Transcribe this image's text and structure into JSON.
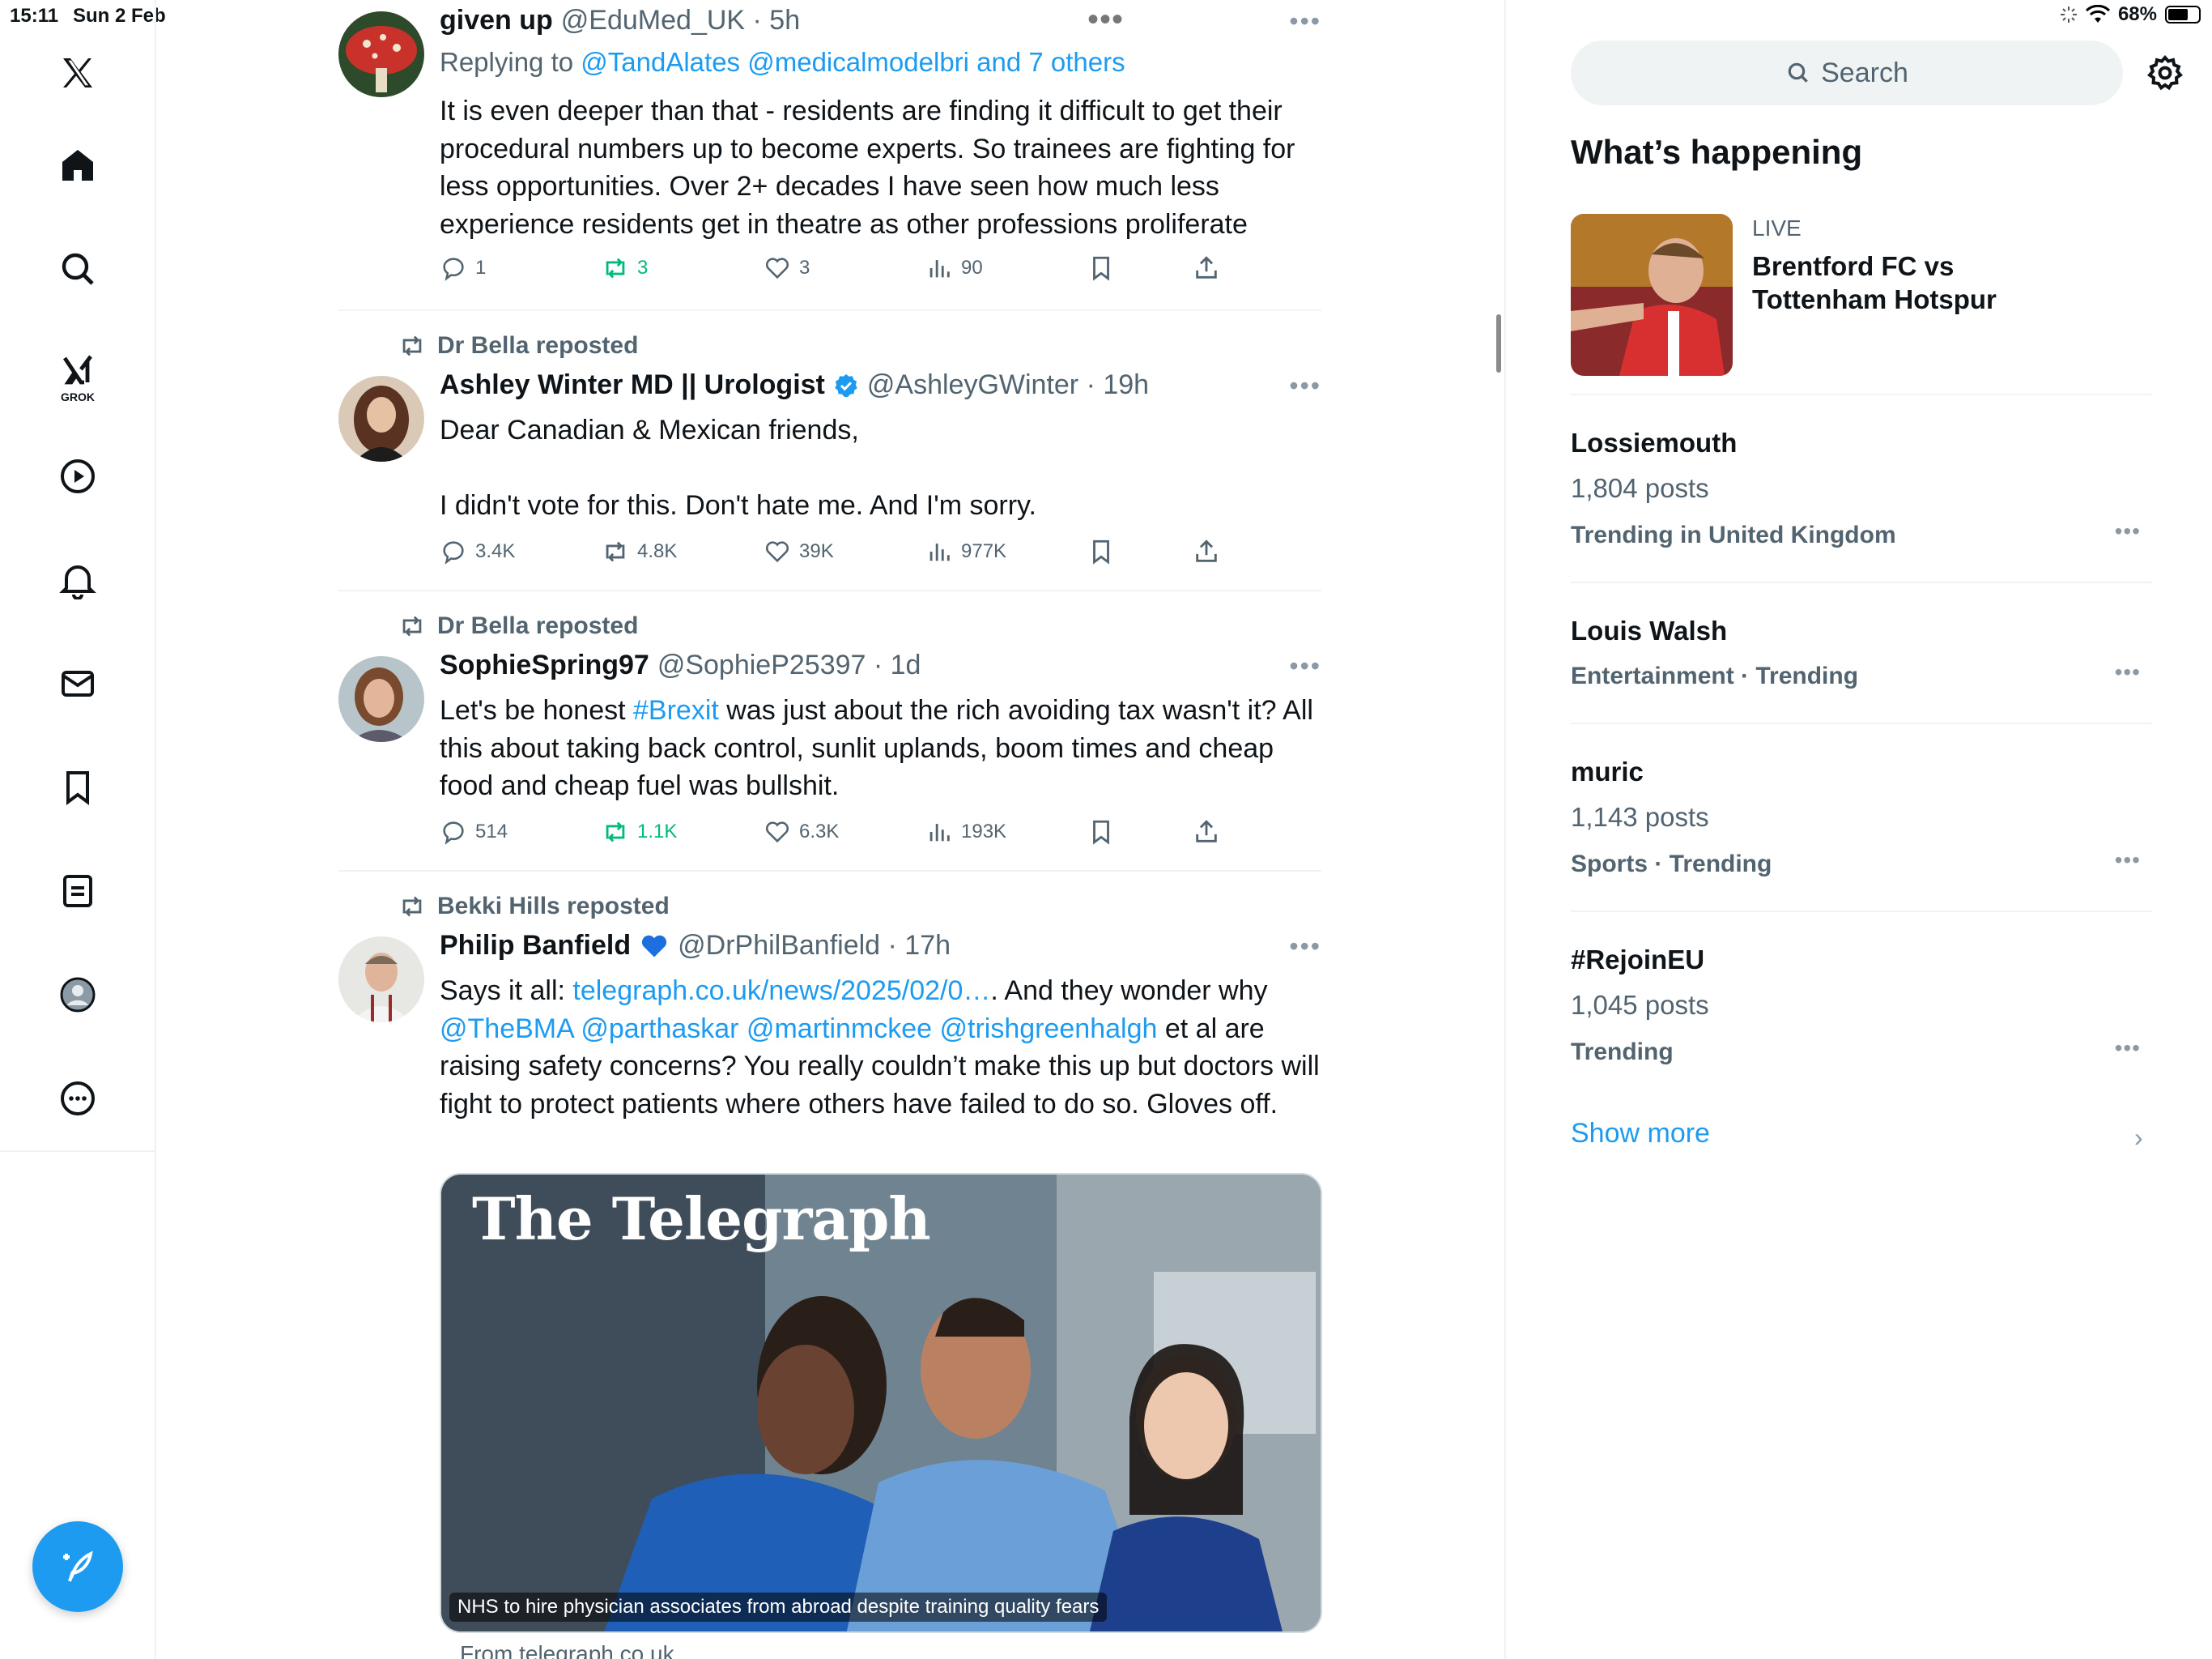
{
  "status": {
    "time": "15:11",
    "date": "Sun 2 Feb",
    "battery": "68%",
    "battery_level": 0.68
  },
  "nav": {
    "grok_label": "GROK"
  },
  "colors": {
    "accent": "#1d9bf0",
    "repost_green": "#00ba7c",
    "muted": "#536471"
  },
  "tweets": [
    {
      "name": "given up",
      "handle": "@EduMed_UK · 5h",
      "replying_prefix": "Replying to",
      "replying_to": "@TandAlates @medicalmodelbri and 7 others",
      "text": "It is even deeper than that - residents are finding it difficult to get their procedural numbers up to become experts. So trainees are fighting for less opportunities. Over 2+ decades I have seen how much less experience residents get in theatre as other professions proliferate",
      "replies": "1",
      "reposts": "3",
      "likes": "3",
      "views": "90"
    },
    {
      "repost_by": "Dr Bella reposted",
      "name": "Ashley Winter MD || Urologist",
      "handle": "@AshleyGWinter · 19h",
      "text_line1": "Dear Canadian & Mexican friends,",
      "text_line2": "I didn't vote for this. Don't hate me. And I'm sorry.",
      "replies": "3.4K",
      "reposts": "4.8K",
      "likes": "39K",
      "views": "977K"
    },
    {
      "repost_by": "Dr Bella reposted",
      "name": "SophieSpring97",
      "handle": "@SophieP25397 · 1d",
      "text_pre": "Let's be honest ",
      "hashtag": "#Brexit",
      "text_post": " was just about the rich avoiding tax wasn't it? All this about taking back control, sunlit uplands, boom times and cheap food and cheap fuel was bullshit.",
      "replies": "514",
      "reposts": "1.1K",
      "likes": "6.3K",
      "views": "193K"
    },
    {
      "repost_by": "Bekki Hills reposted",
      "name": "Philip Banfield",
      "handle": "@DrPhilBanfield · 17h",
      "text_pre": "Says it all: ",
      "link": "telegraph.co.uk/news/2025/02/0…",
      "text_mid": ". And they wonder why ",
      "mentions": "@TheBMA @parthaskar @martinmckee @trishgreenhalgh",
      "text_post": " et al are raising safety concerns? You really couldn’t make this up but doctors will fight to protect patients where others have failed to do so. Gloves off.",
      "card_title": "The Telegraph",
      "card_caption": "NHS to hire physician associates from abroad despite training quality fears",
      "card_from": "From telegraph.co.uk"
    }
  ],
  "right": {
    "search_placeholder": "Search",
    "heading": "What’s happening",
    "live_tag": "LIVE",
    "live_title": "Brentford FC vs Tottenham Hotspur",
    "trends": [
      {
        "name": "Lossiemouth",
        "posts": "1,804 posts",
        "meta": "Trending in United Kingdom"
      },
      {
        "name": "Louis Walsh",
        "posts": "",
        "meta": "Entertainment · Trending"
      },
      {
        "name": "muric",
        "posts": "1,143 posts",
        "meta": "Sports · Trending"
      },
      {
        "name": "#RejoinEU",
        "posts": "1,045 posts",
        "meta": "Trending"
      }
    ],
    "show_more": "Show more"
  }
}
